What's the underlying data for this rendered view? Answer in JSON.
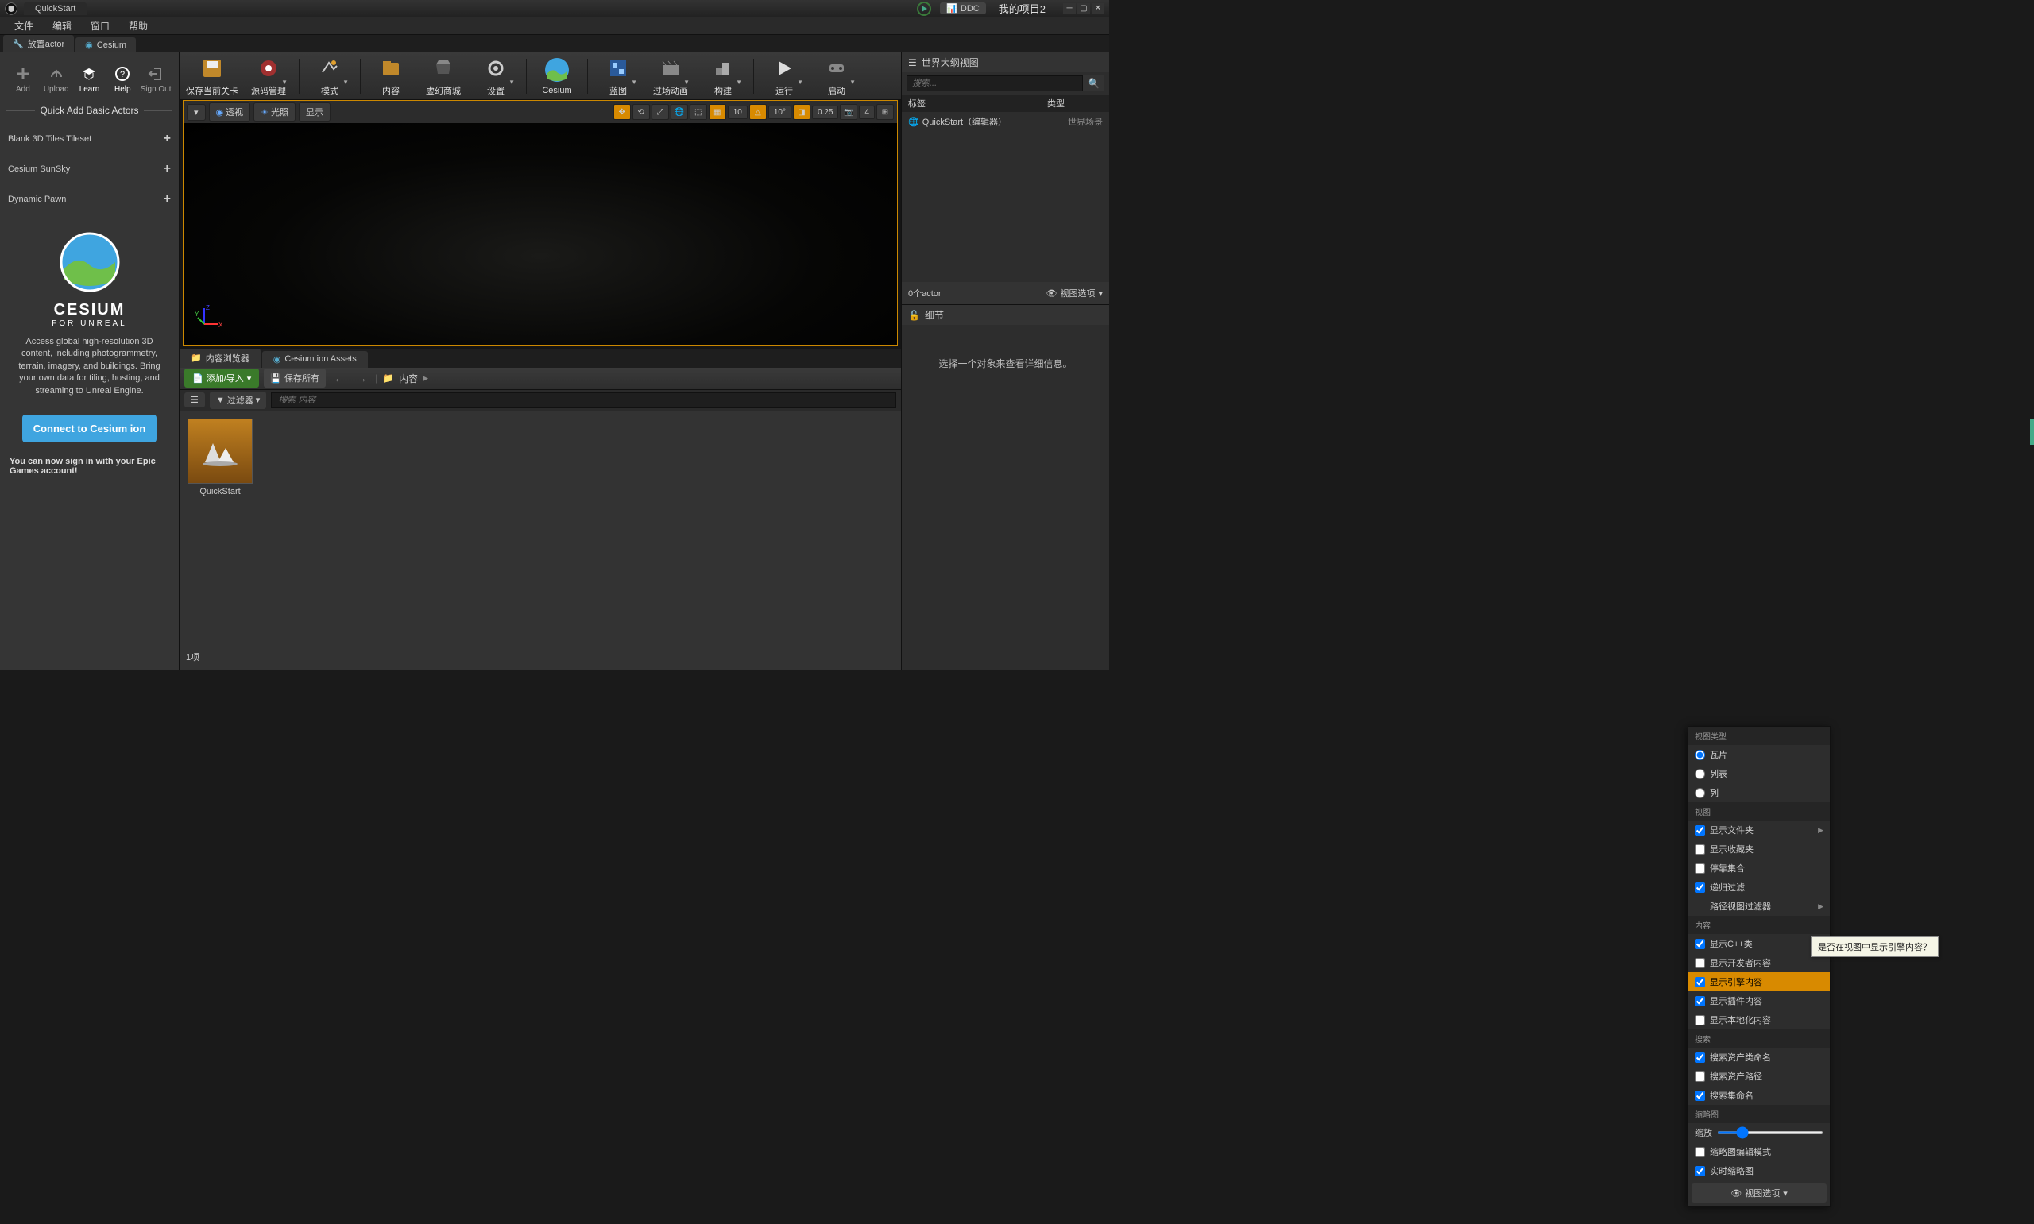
{
  "title_tab": "QuickStart",
  "ddc": "DDC",
  "project_name": "我的项目2",
  "menus": [
    "文件",
    "编辑",
    "窗口",
    "帮助"
  ],
  "editor_tabs": [
    "放置actor",
    "Cesium"
  ],
  "left": {
    "actions": [
      "Add",
      "Upload",
      "Learn",
      "Help",
      "Sign Out"
    ],
    "section": "Quick Add Basic Actors",
    "items": [
      "Blank 3D Tiles Tileset",
      "Cesium SunSky",
      "Dynamic Pawn"
    ],
    "brand_top": "CESIUM",
    "brand_sub": "FOR UNREAL",
    "desc": "Access global high-resolution 3D content, including photogrammetry, terrain, imagery, and buildings. Bring your own data for tiling, hosting, and streaming to Unreal Engine.",
    "connect": "Connect to Cesium ion",
    "note": "You can now sign in with your Epic Games account!"
  },
  "toolbar": [
    "保存当前关卡",
    "源码管理",
    "模式",
    "内容",
    "虚幻商城",
    "设置",
    "Cesium",
    "蓝图",
    "过场动画",
    "构建",
    "运行",
    "启动"
  ],
  "viewport": {
    "left_buttons": [
      "透视",
      "光照",
      "显示"
    ],
    "nums": {
      "speed": "10",
      "angle": "10°",
      "scale": "0.25",
      "cam": "4"
    }
  },
  "bottom_tabs": [
    "内容浏览器",
    "Cesium ion Assets"
  ],
  "cb": {
    "add": "添加/导入",
    "save_all": "保存所有",
    "crumb": "内容",
    "filter": "过滤器",
    "search_ph": "搜索 内容",
    "asset": "QuickStart",
    "status": "1项"
  },
  "popup": {
    "s1": "视图类型",
    "r1": "瓦片",
    "r2": "列表",
    "r3": "列",
    "s2": "视图",
    "v1": "显示文件夹",
    "v2": "显示收藏夹",
    "v3": "停靠集合",
    "v4": "递归过滤",
    "v5": "路径视图过滤器",
    "s3": "内容",
    "c1": "显示C++类",
    "c2": "显示开发者内容",
    "c3": "显示引擎内容",
    "c4": "显示插件内容",
    "c5": "显示本地化内容",
    "s4": "搜索",
    "q1": "搜索资产类命名",
    "q2": "搜索资产路径",
    "q3": "搜索集命名",
    "s5": "缩略图",
    "scale": "缩放",
    "t1": "缩略图编辑模式",
    "t2": "实时缩略图",
    "footer": "视图选项"
  },
  "tooltip": "是否在视图中显示引擎内容？",
  "outliner": {
    "title": "世界大纲视图",
    "search_ph": "搜索...",
    "col1": "标签",
    "col2": "类型",
    "row_label": "QuickStart（编辑器）",
    "row_type": "世界场景",
    "count": "0个actor",
    "viewopt": "视图选项"
  },
  "details": {
    "title": "细节",
    "hint": "选择一个对象来查看详细信息。"
  }
}
